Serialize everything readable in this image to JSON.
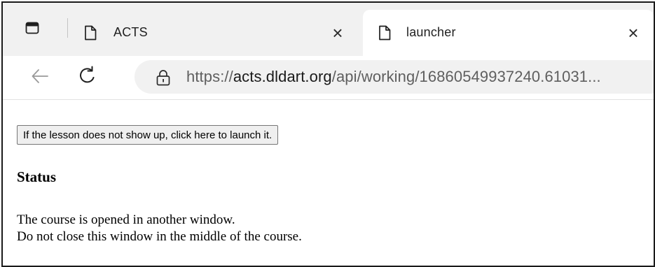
{
  "browser": {
    "tabs": [
      {
        "title": "ACTS",
        "active": false,
        "icon": "page-icon"
      },
      {
        "title": "launcher",
        "active": true,
        "icon": "page-icon"
      }
    ],
    "close_glyph": "×",
    "address_bar": {
      "scheme": "https://",
      "host": "acts.dldart.org",
      "path": "/api/working/16860549937240.61031..."
    }
  },
  "page": {
    "launch_button_label": "If the lesson does not show up, click here to launch it.",
    "status_heading": "Status",
    "status_lines": [
      "The course is opened in another window.",
      "Do not close this window in the middle of the course."
    ]
  }
}
